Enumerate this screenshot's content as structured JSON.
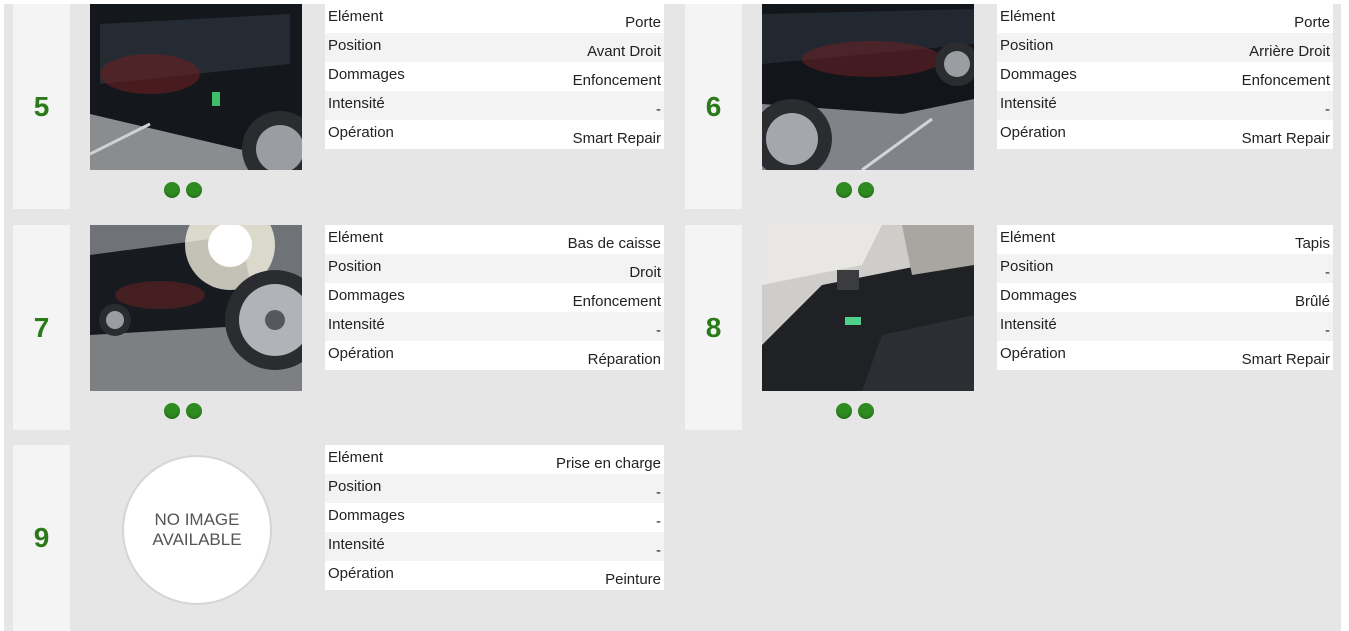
{
  "labels": {
    "element": "Elément",
    "position": "Position",
    "dommages": "Dommages",
    "intensite": "Intensité",
    "operation": "Opération"
  },
  "no_image": {
    "line1": "NO IMAGE",
    "line2": "AVAILABLE"
  },
  "colors": {
    "number": "#2a7a1a",
    "dot": "#2e8b1f",
    "panel": "#e6e6e6"
  },
  "cards": [
    {
      "number": "5",
      "element": "Porte",
      "position": "Avant Droit",
      "dommages": "Enfoncement",
      "intensite": "-",
      "operation": "Smart Repair"
    },
    {
      "number": "6",
      "element": "Porte",
      "position": "Arrière Droit",
      "dommages": "Enfoncement",
      "intensite": "-",
      "operation": "Smart Repair"
    },
    {
      "number": "7",
      "element": "Bas de caisse",
      "position": "Droit",
      "dommages": "Enfoncement",
      "intensite": "-",
      "operation": "Réparation"
    },
    {
      "number": "8",
      "element": "Tapis",
      "position": "-",
      "dommages": "Brûlé",
      "intensite": "-",
      "operation": "Smart Repair"
    },
    {
      "number": "9",
      "element": "Prise en charge",
      "position": "-",
      "dommages": "-",
      "intensite": "-",
      "operation": "Peinture"
    }
  ]
}
